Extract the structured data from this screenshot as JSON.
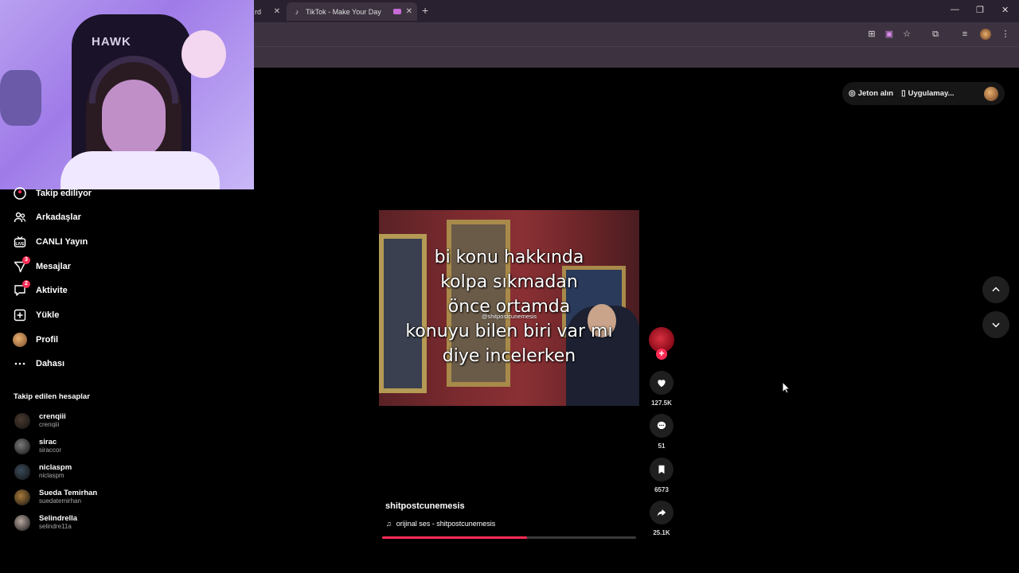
{
  "browser": {
    "tab_partial_label": "rd",
    "active_tab_title": "TikTok - Make Your Day",
    "new_tab_icon": "plus-icon"
  },
  "header": {
    "coins_label": "Jeton alın",
    "app_label": "Uygulamay..."
  },
  "sidebar": {
    "items": [
      {
        "label": "Takip ediliyor",
        "icon": "following-icon"
      },
      {
        "label": "Arkadaşlar",
        "icon": "friends-icon"
      },
      {
        "label": "CANLI Yayın",
        "icon": "live-icon"
      },
      {
        "label": "Mesajlar",
        "icon": "messages-icon",
        "badge": "3"
      },
      {
        "label": "Aktivite",
        "icon": "activity-icon",
        "badge": "2"
      },
      {
        "label": "Yükle",
        "icon": "upload-icon"
      },
      {
        "label": "Profil",
        "icon": "profile-avatar"
      },
      {
        "label": "Dahası",
        "icon": "more-icon"
      }
    ],
    "following_title": "Takip edilen hesaplar",
    "accounts": [
      {
        "name": "crenqiii",
        "username": "crenqiii",
        "color": "#4a3a30"
      },
      {
        "name": "sirac",
        "username": "siraccor",
        "color": "#7a7a7a"
      },
      {
        "name": "niclaspm",
        "username": "niclaspm",
        "color": "#3a4a5a"
      },
      {
        "name": "Sueda Temirhan",
        "username": "suedatemirhan",
        "color": "#a87a3a"
      },
      {
        "name": "Selindrella",
        "username": "selindre11a",
        "color": "#b8a8a0"
      }
    ]
  },
  "video": {
    "caption_lines": [
      "bi konu hakkında",
      "kolpa sıkmadan",
      "önce ortamda",
      "konuyu bilen biri var mı",
      "diye incelerken"
    ],
    "watermark": "@shitpostcunemesis",
    "author": "shitpostcunemesis",
    "music": "orijinal ses - shitpostcunemesis",
    "progress_fraction": 0.57
  },
  "actions": {
    "likes": "127.5K",
    "comments": "51",
    "saves": "6573",
    "shares": "25.1K"
  },
  "colors": {
    "accent": "#fe2c55",
    "chrome": "#3d3340"
  }
}
